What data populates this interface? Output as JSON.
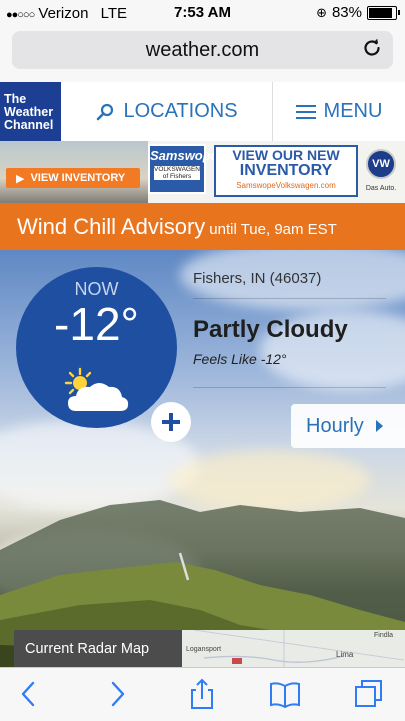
{
  "status_bar": {
    "signal_dots": "●●○○○",
    "carrier": "Verizon",
    "network": "LTE",
    "time": "7:53 AM",
    "battery_percent": "83%",
    "battery_level": 0.83
  },
  "browser": {
    "url": "weather.com"
  },
  "site_header": {
    "logo_lines": [
      "The",
      "Weather",
      "Channel"
    ],
    "locations_label": "LOCATIONS",
    "menu_label": "MENU"
  },
  "ad": {
    "button_label": "VIEW INVENTORY",
    "dealer_logo_top": "Samswope",
    "dealer_logo_bottom": "VOLKSWAGEN of Fishers",
    "headline_line1": "VIEW OUR NEW",
    "headline_line2": "INVENTORY",
    "site": "SamswopeVolkswagen.com",
    "brand_mark": "VW",
    "brand_tagline": "Das Auto."
  },
  "advisory": {
    "title": "Wind Chill Advisory",
    "detail": "until Tue, 9am EST"
  },
  "current": {
    "now_label": "NOW",
    "temperature": "-12°",
    "location": "Fishers, IN (46037)",
    "condition": "Partly Cloudy",
    "feels_like": "Feels Like -12°",
    "icon": "partly-cloudy-icon"
  },
  "hourly_label": "Hourly",
  "radar": {
    "label": "Current Radar Map",
    "map_places": [
      "Logansport",
      "Lima",
      "Findla"
    ]
  },
  "colors": {
    "brand_blue": "#1c3f94",
    "link_blue": "#2a73b9",
    "advisory_orange": "#e8741e",
    "circle_blue": "#1e4fa1"
  }
}
